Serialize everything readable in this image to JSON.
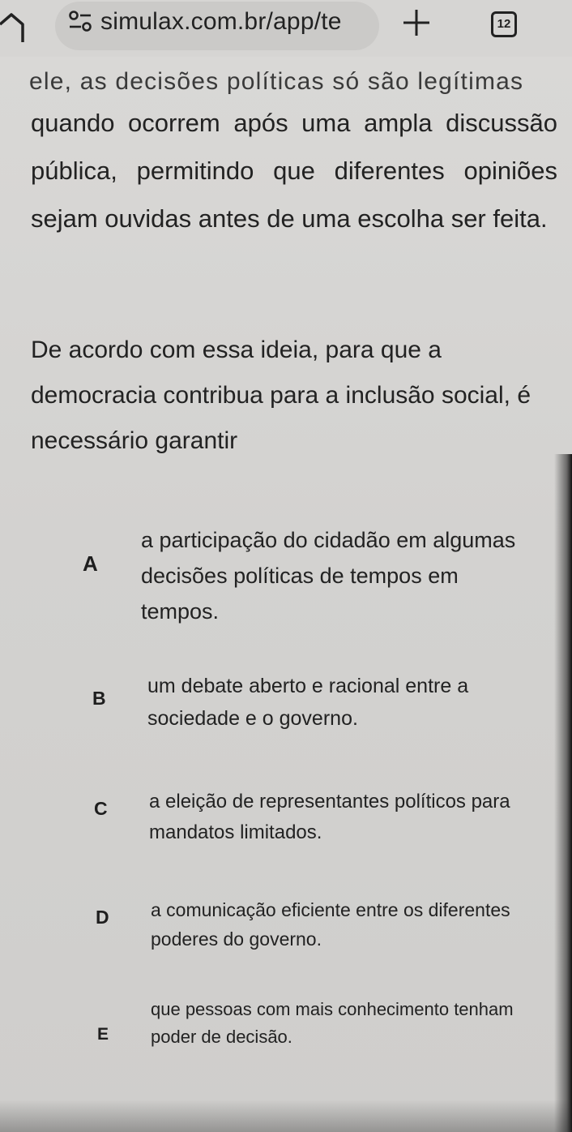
{
  "browser": {
    "url": "simulax.com.br/app/te",
    "tab_count": "12",
    "icons": {
      "home": "home-icon",
      "site_settings": "site-settings-icon",
      "new_tab": "plus-icon",
      "tabs": "tab-switcher-icon"
    }
  },
  "question": {
    "cut_line": "ele, as decisões políticas só são legítimas",
    "passage": "quando ocorrem após uma ampla discussão pública, permitindo que diferentes opiniões sejam ouvidas antes de uma escolha ser feita.",
    "prompt": "De acordo com essa ideia, para que a democracia contribua para a inclusão social, é necessário garantir"
  },
  "options": [
    {
      "letter": "A",
      "text": "a participação do cidadão em algumas decisões políticas de tempos em tempos."
    },
    {
      "letter": "B",
      "text": "um debate aberto e racional entre a sociedade e o governo."
    },
    {
      "letter": "C",
      "text": "a eleição de representantes políticos para mandatos limitados."
    },
    {
      "letter": "D",
      "text": "a comunicação eficiente entre os diferentes poderes do governo."
    },
    {
      "letter": "E",
      "text": "que pessoas com mais conhecimento tenham poder de decisão."
    }
  ]
}
